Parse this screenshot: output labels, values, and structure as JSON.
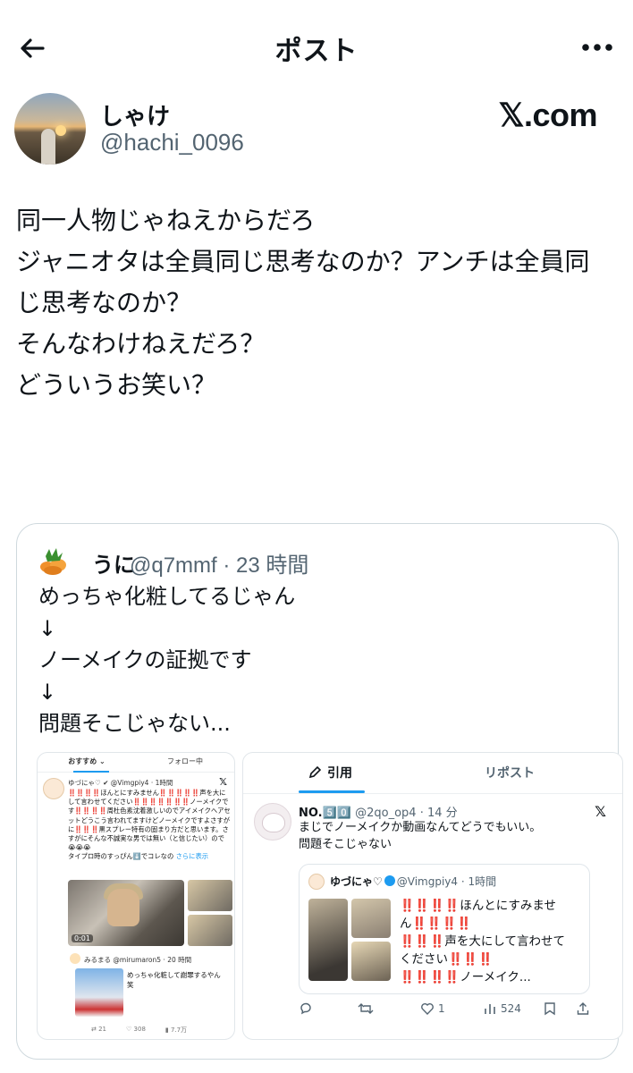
{
  "header": {
    "title": "ポスト"
  },
  "post": {
    "display_name": "しゃけ",
    "handle": "@hachi_0096",
    "source_label": "𝕏.com",
    "body_lines": [
      "同一人物じゃねえからだろ",
      "",
      "ジャニオタは全員同じ思考なのか？アンチは全員同",
      "じ思考なのか？",
      "そんなわけねえだろ？",
      "",
      "どういうお笑い？"
    ]
  },
  "quote": {
    "name": "うに",
    "meta": "@q7mmf · 23 時間",
    "text": "めっちゃ化粧してるじゃん\n↓\nノーメイクの証拠です\n↓\n問題そこじゃない..."
  },
  "screenshot1": {
    "tab_recommended": "おすすめ ⌄",
    "tab_following": "フォロー中",
    "author_line": "ゆづにゃ♡ ✔ @Vimgpiy4 · 1時間",
    "body": "‼️‼️‼️‼️ほんとにすみません‼️‼️‼️‼️‼️声を大にして言わせてください‼️‼️‼️‼️‼️‼️‼️ノーメイクです‼️‼️‼️‼️周杜色素沈着激しいのでアイメイクヘアセットどうこう言われてますけどノーメイクですよさすがに‼️‼️‼️黒スプレー特有の固まり方だと思います。さすがにそんな不誠実な男では無い（と信じたい）ので😭😭😭\nタイプロ時のすっぴん⬇️でコレなの",
    "more_label": "さらに表示",
    "video_time": "0:01",
    "reply_author": "みるまる @mirumaron5 · 20 時間",
    "reply_text": "めっちゃ化粧して謝罪するやん\n笑",
    "actions": [
      "21",
      "308",
      "7.7万"
    ]
  },
  "screenshot2": {
    "tab_quotes": "引用",
    "tab_reposts": "リポスト",
    "name": "NO.5️⃣0️⃣",
    "meta": "@2qo_op4 · 14 分",
    "body": "まじでノーメイクか動画なんてどうでもいい。\n問題そこじゃない",
    "inner_name": "ゆづにゃ♡",
    "inner_meta": "@Vimgpiy4 · 1時間",
    "inner_text": "‼️‼️‼️‼️ほんとにすみません‼️‼️‼️‼️\n‼️‼️‼️声を大にして言わせてください‼️‼️‼️\n‼️‼️‼️‼️ノーメイク...",
    "likes": "1",
    "views": "524"
  }
}
